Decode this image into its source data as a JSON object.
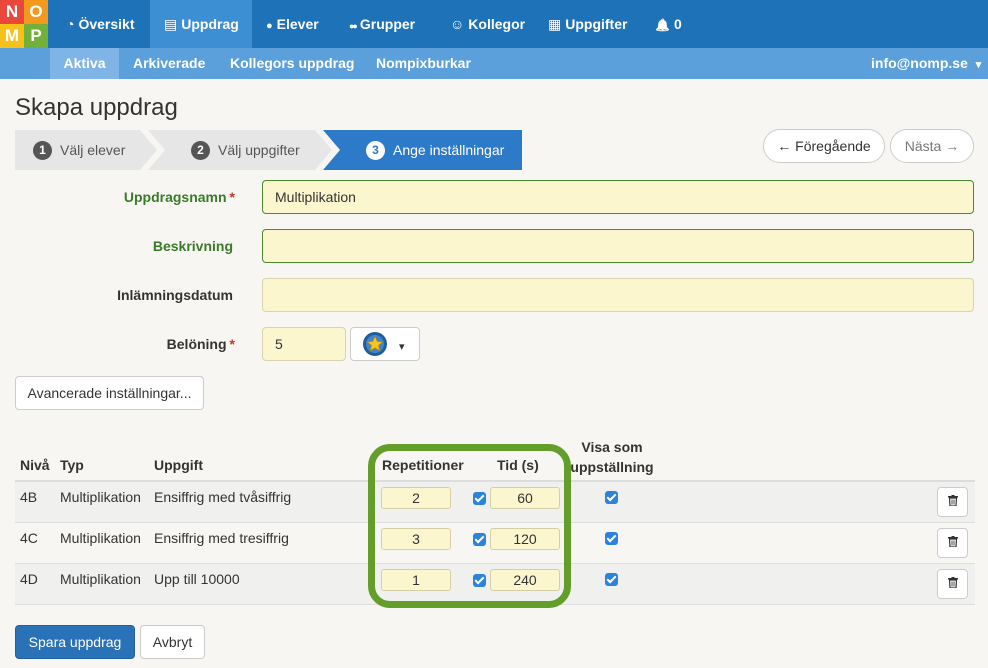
{
  "logo": {
    "letters": [
      "N",
      "O",
      "M",
      "P"
    ],
    "colors": [
      "#e8473b",
      "#f39a1e",
      "#f4c21a",
      "#72b03a"
    ]
  },
  "topnav": {
    "items": [
      {
        "icon": "dashboard-icon",
        "glyph": "◔",
        "label": "Översikt"
      },
      {
        "icon": "book-icon",
        "glyph": "▤",
        "label": "Uppdrag"
      },
      {
        "icon": "user-icon",
        "glyph": "●",
        "label": "Elever"
      },
      {
        "icon": "users-icon",
        "glyph": "●●",
        "label": "Grupper"
      },
      {
        "icon": "smile-icon",
        "glyph": "☺",
        "label": "Kollegor"
      },
      {
        "icon": "grid-icon",
        "glyph": "▦",
        "label": "Uppgifter"
      },
      {
        "icon": "bell-icon",
        "glyph": "🔔",
        "label": "0"
      }
    ]
  },
  "subnav": {
    "items": [
      "Aktiva",
      "Arkiverade",
      "Kollegors uppdrag",
      "Nompixburkar"
    ],
    "user": "info@nomp.se",
    "caret": "▾"
  },
  "page": {
    "title": "Skapa uppdrag"
  },
  "steps": [
    {
      "num": "1",
      "label": "Välj elever"
    },
    {
      "num": "2",
      "label": "Välj uppgifter"
    },
    {
      "num": "3",
      "label": "Ange inställningar"
    }
  ],
  "stepnav": {
    "prev": "← Föregående",
    "next": "Nästa →"
  },
  "form": {
    "name_label": "Uppdragsnamn",
    "name_value": "Multiplikation",
    "required_mark": "*",
    "desc_label": "Beskrivning",
    "desc_value": "",
    "date_label": "Inlämningsdatum",
    "date_value": "",
    "reward_label": "Belöning",
    "reward_value": "5",
    "reward_caret": "▾",
    "advanced_button": "Avancerade inställningar..."
  },
  "table": {
    "headers": {
      "level": "Nivå",
      "type": "Typ",
      "task": "Uppgift",
      "reps": "Repetitioner",
      "time": "Tid (s)",
      "show_line1": "Visa som",
      "show_line2": "uppställning"
    },
    "rows": [
      {
        "level": "4B",
        "type": "Multiplikation",
        "task": "Ensiffrig med tvåsiffrig",
        "reps": "2",
        "time": "60"
      },
      {
        "level": "4C",
        "type": "Multiplikation",
        "task": "Ensiffrig med tresiffrig",
        "reps": "3",
        "time": "120"
      },
      {
        "level": "4D",
        "type": "Multiplikation",
        "task": "Upp till 10000",
        "reps": "1",
        "time": "240"
      }
    ]
  },
  "actions": {
    "save": "Spara uppdrag",
    "cancel": "Avbryt"
  }
}
